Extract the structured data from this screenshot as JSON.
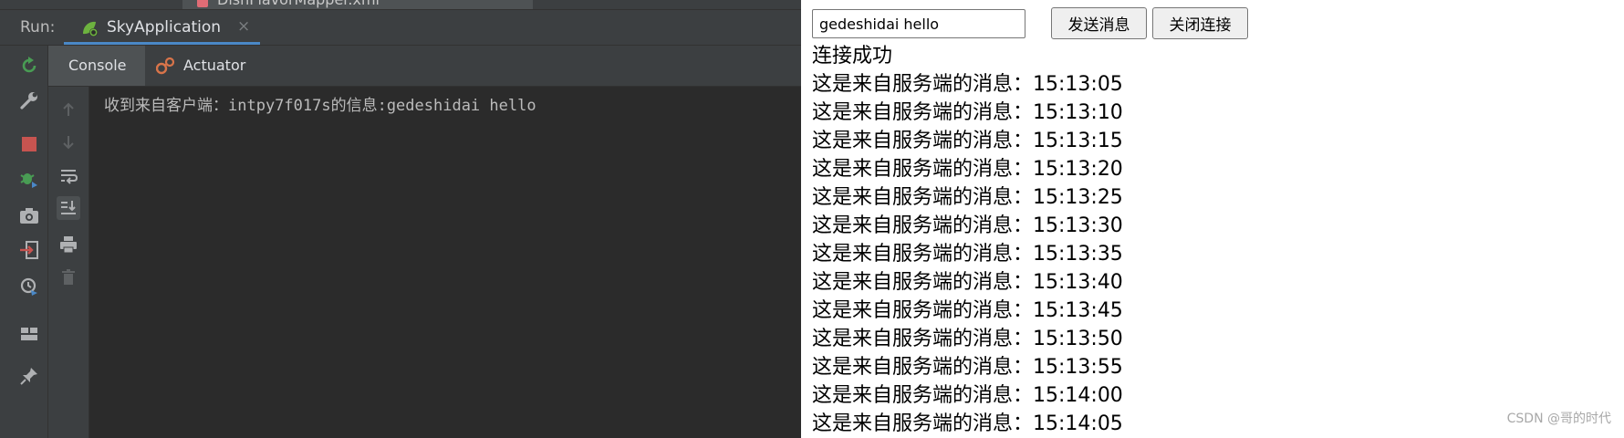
{
  "ide": {
    "file_tab": "DishFlavorMapper.xml",
    "run_label": "Run:",
    "run_tab_title": "SkyApplication",
    "run_tab_close": "×",
    "tabs": [
      {
        "label": "Console"
      },
      {
        "label": "Actuator"
      }
    ],
    "console_lines": [
      "收到来自客户端：intpy7f017s的信息:gedeshidai hello"
    ],
    "colors": {
      "background": "#2b2b2b",
      "panel": "#3c3f41",
      "accent": "#4a88c7",
      "stop": "#c75450",
      "rerun": "#499c54"
    },
    "left_toolbar_icons": [
      "rerun-icon",
      "settings-wrench-icon",
      "stop-icon",
      "debug-icon",
      "camera-icon",
      "login-icon",
      "profiler-icon",
      "layout-icon",
      "pin-icon"
    ],
    "gutter_icons": [
      "scroll-up-icon",
      "scroll-down-icon",
      "soft-wrap-icon",
      "scroll-to-end-icon",
      "print-icon",
      "trash-icon"
    ]
  },
  "web": {
    "input_value": "gedeshidai hello",
    "send_button": "发送消息",
    "close_button": "关闭连接",
    "messages": [
      "连接成功",
      "这是来自服务端的消息：15:13:05",
      "这是来自服务端的消息：15:13:10",
      "这是来自服务端的消息：15:13:15",
      "这是来自服务端的消息：15:13:20",
      "这是来自服务端的消息：15:13:25",
      "这是来自服务端的消息：15:13:30",
      "这是来自服务端的消息：15:13:35",
      "这是来自服务端的消息：15:13:40",
      "这是来自服务端的消息：15:13:45",
      "这是来自服务端的消息：15:13:50",
      "这是来自服务端的消息：15:13:55",
      "这是来自服务端的消息：15:14:00",
      "这是来自服务端的消息：15:14:05"
    ],
    "watermark": "CSDN @哥的时代"
  }
}
